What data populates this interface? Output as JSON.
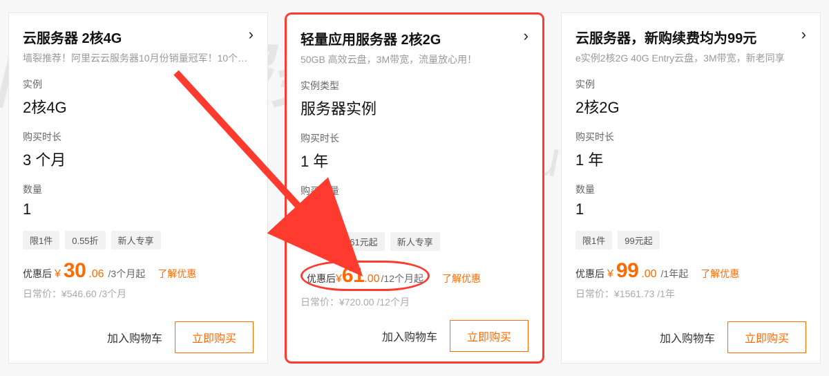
{
  "watermark1": "阿里云服务器",
  "watermark2": "aliyunfuwuqi.com",
  "common": {
    "price_prefix": "优惠后",
    "currency": "¥",
    "learn_more": "了解优惠",
    "original_prefix": "日常价：",
    "add_to_cart": "加入购物车",
    "buy_now": "立即购买"
  },
  "cards": [
    {
      "title": "云服务器 2核4G",
      "subtitle": "墙裂推荐！阿里云云服务器10月份销量冠军！10个…",
      "instance_label": "实例",
      "instance_value": "2核4G",
      "duration_label": "购买时长",
      "duration_value": "3 个月",
      "qty_label": "数量",
      "qty_value": "1",
      "tags": [
        "限1件",
        "0.55折",
        "新人专享"
      ],
      "price_main": "30",
      "price_sub": ".06",
      "per": "/3个月起",
      "original": "¥546.60 /3个月"
    },
    {
      "title": "轻量应用服务器 2核2G",
      "subtitle": "50GB 高效云盘，3M带宽，流量放心用！",
      "instance_label": "实例类型",
      "instance_value": "服务器实例",
      "duration_label": "购买时长",
      "duration_value": "1 年",
      "qty_label": "购买数量",
      "qty_value": "1",
      "tags": [
        "限1件",
        "61元起",
        "新人专享"
      ],
      "price_main": "61",
      "price_sub": ".00",
      "per": "/12个月起",
      "original": "¥720.00 /12个月"
    },
    {
      "title": "云服务器，新购续费均为99元",
      "subtitle": "e实例2核2G 40G Entry云盘，3M带宽，新老同享",
      "instance_label": "实例",
      "instance_value": "2核2G",
      "duration_label": "购买时长",
      "duration_value": "1 年",
      "qty_label": "数量",
      "qty_value": "1",
      "tags": [
        "限1件",
        "99元起"
      ],
      "price_main": "99",
      "price_sub": ".00",
      "per": "/1年起",
      "original": "¥1561.73 /1年"
    }
  ]
}
